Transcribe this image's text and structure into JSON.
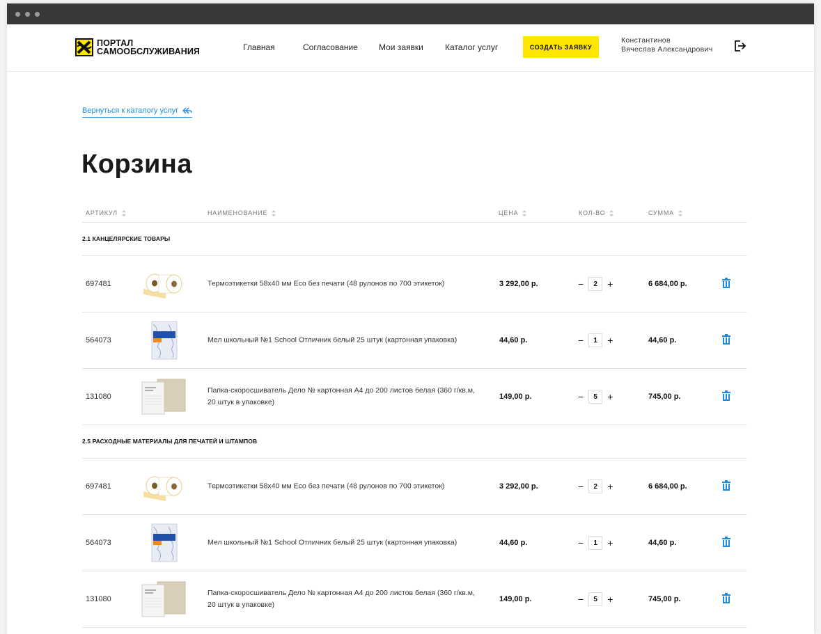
{
  "header": {
    "logo_line1": "ПОРТАЛ",
    "logo_line2": "САМООБСЛУЖИВАНИЯ",
    "nav": [
      "Главная",
      "Согласование",
      "Мои заявки",
      "Каталог услуг"
    ],
    "create_button": "СОЗДАТЬ ЗАЯВКУ",
    "user_line1": "Константинов",
    "user_line2": "Вячеслав Александрович"
  },
  "back_link": "Вернуться к каталогу услуг",
  "title": "Корзина",
  "columns": [
    "АРТИКУЛ",
    "НАИМЕНОВАНИЕ",
    "ЦЕНА",
    "КОЛ-ВО",
    "СУММА"
  ],
  "groups": [
    {
      "name": "2.1 КАНЦЕЛЯРСКИЕ ТОВАРЫ",
      "items": [
        {
          "sku": "697481",
          "image": "label-rolls-image",
          "name": "Термоэтикетки 58х40 мм Eco без печати (48 рулонов по 700 этикеток)",
          "price": "3 292,00 р.",
          "qty": "2",
          "sum": "6 684,00 р."
        },
        {
          "sku": "564073",
          "image": "chalk-box-image",
          "name": "Мел школьный №1 School Отличник белый 25 штук (картонная упаковка)",
          "price": "44,60 р.",
          "qty": "1",
          "sum": "44,60 р."
        },
        {
          "sku": "131080",
          "image": "folder-image",
          "name": "Папка-скоросшиватель Дело № картонная А4 до 200 листов белая (360 г/кв.м, 20 штук в упаковке)",
          "price": "149,00 р.",
          "qty": "5",
          "sum": "745,00 р."
        }
      ]
    },
    {
      "name": "2.5 РАСХОДНЫЕ МАТЕРИАЛЫ ДЛЯ ПЕЧАТЕЙ И ШТАМПОВ",
      "items": [
        {
          "sku": "697481",
          "image": "label-rolls-image",
          "name": "Термоэтикетки 58х40 мм Eco без печати (48 рулонов по 700 этикеток)",
          "price": "3 292,00 р.",
          "qty": "2",
          "sum": "6 684,00 р."
        },
        {
          "sku": "564073",
          "image": "chalk-box-image",
          "name": "Мел школьный №1 School Отличник белый 25 штук (картонная упаковка)",
          "price": "44,60 р.",
          "qty": "1",
          "sum": "44,60 р."
        },
        {
          "sku": "131080",
          "image": "folder-image",
          "name": "Папка-скоросшиватель Дело № картонная А4 до 200 листов белая (360 г/кв.м, 20 штук в упаковке)",
          "price": "149,00 р.",
          "qty": "5",
          "sum": "745,00 р."
        }
      ]
    }
  ],
  "colors": {
    "accent": "#fee600",
    "link": "#1d8ce0",
    "titlebar": "#383838"
  }
}
